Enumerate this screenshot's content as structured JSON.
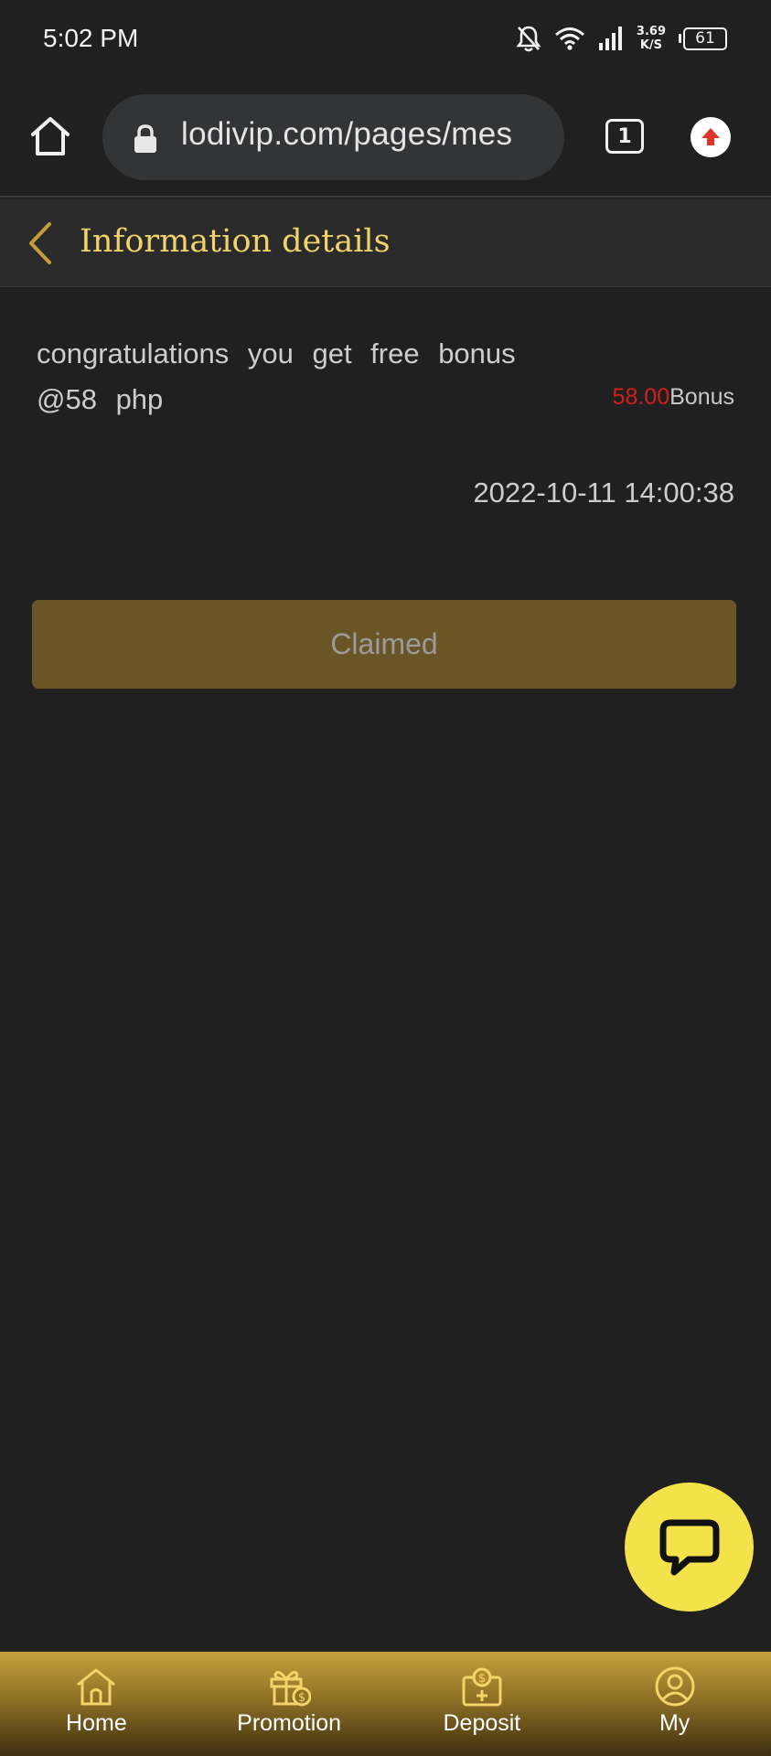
{
  "status_bar": {
    "time": "5:02 PM",
    "net_speed_value": "3.69",
    "net_speed_unit": "K/S",
    "battery": "61"
  },
  "browser": {
    "url": "lodivip.com/pages/mes",
    "tab_count": "1"
  },
  "header": {
    "title": "Information details"
  },
  "message": {
    "text": "congratulations you get free bonus @58 php",
    "bonus_amount": "58.00",
    "bonus_label": "Bonus",
    "timestamp": "2022-10-11 14:00:38",
    "claim_label": "Claimed"
  },
  "bottom_nav": {
    "items": [
      {
        "label": "Home",
        "icon": "home-icon"
      },
      {
        "label": "Promotion",
        "icon": "gift-icon"
      },
      {
        "label": "Deposit",
        "icon": "deposit-icon"
      },
      {
        "label": "My",
        "icon": "user-icon"
      }
    ]
  },
  "colors": {
    "background": "#202020",
    "accent_gold": "#f1d36a",
    "button_gold": "#6a5527",
    "bonus_red": "#d41e1e",
    "chat_yellow": "#f3e24a"
  }
}
